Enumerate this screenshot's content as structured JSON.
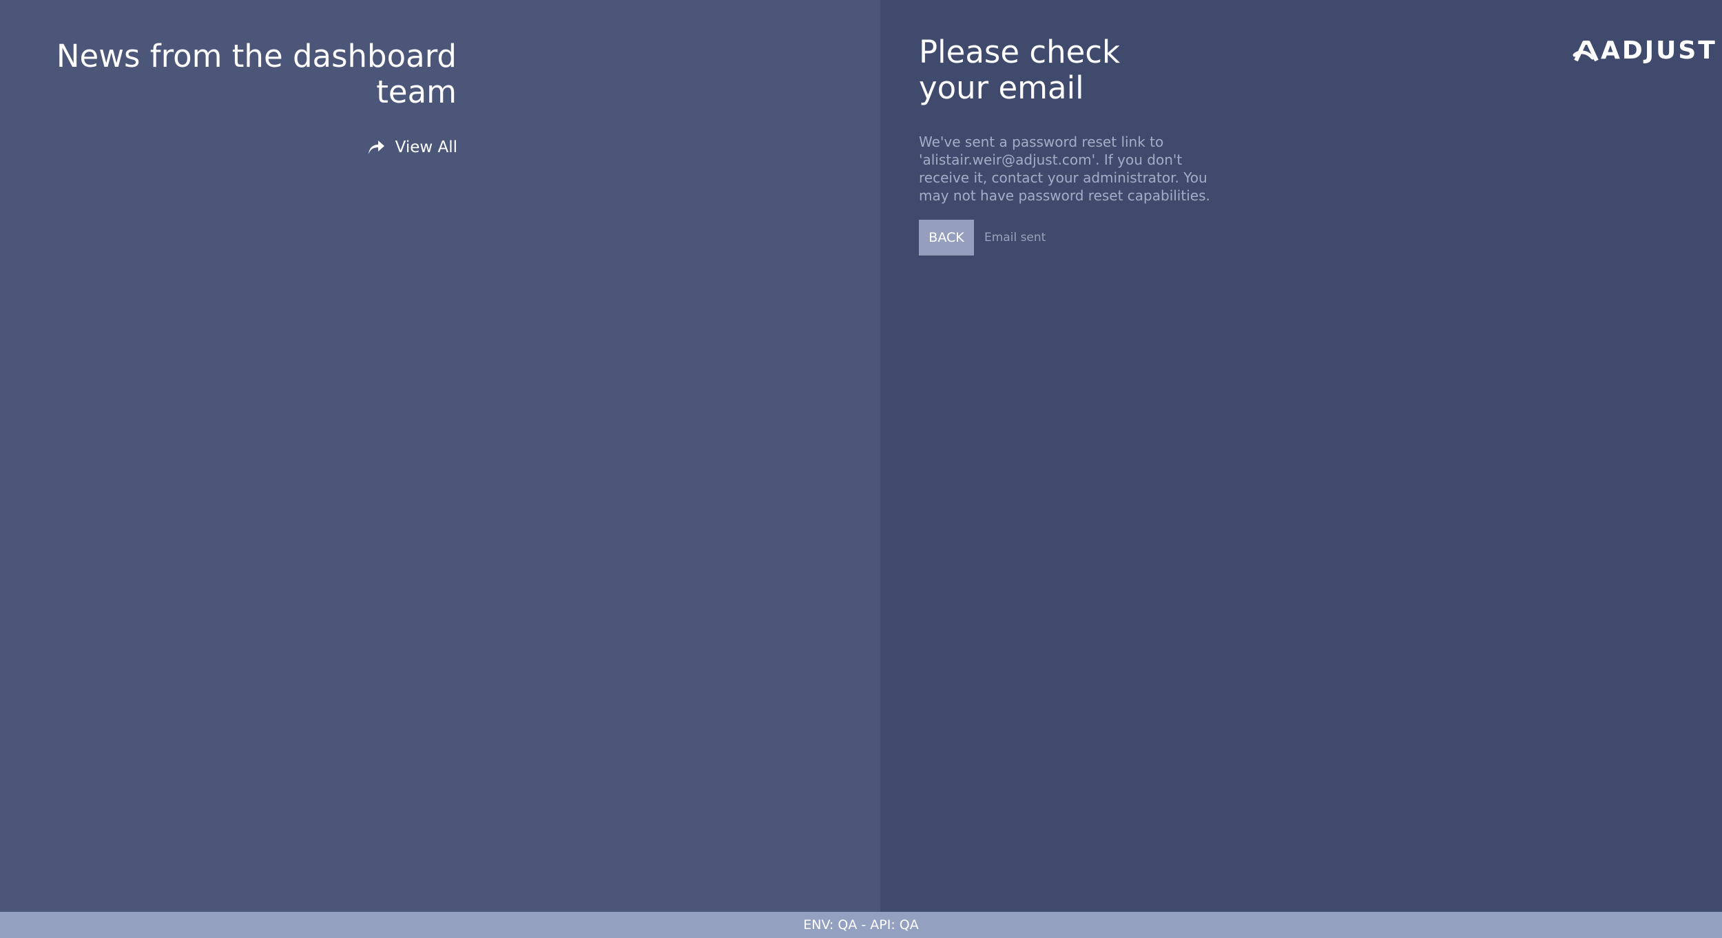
{
  "news": {
    "title": "News from the dashboard team",
    "view_all_label": "View All",
    "view_all_icon": "share-arrow-icon"
  },
  "brand": {
    "logo_text": "ADJUST",
    "logo_icon": "adjust-logo-mark"
  },
  "reset": {
    "title": "Please check your email",
    "message": "We've sent a password reset link to 'alistair.weir@adjust.com'. If you don't receive it, contact your administrator. You may not have password reset capabilities.",
    "back_label": "BACK",
    "status": "Email sent"
  },
  "footer": {
    "env_text": "ENV: QA - API: QA"
  },
  "colors": {
    "left_panel": "#4b5679",
    "right_panel": "#404a6d",
    "button": "#959fbd",
    "footer": "#94a0bf"
  }
}
